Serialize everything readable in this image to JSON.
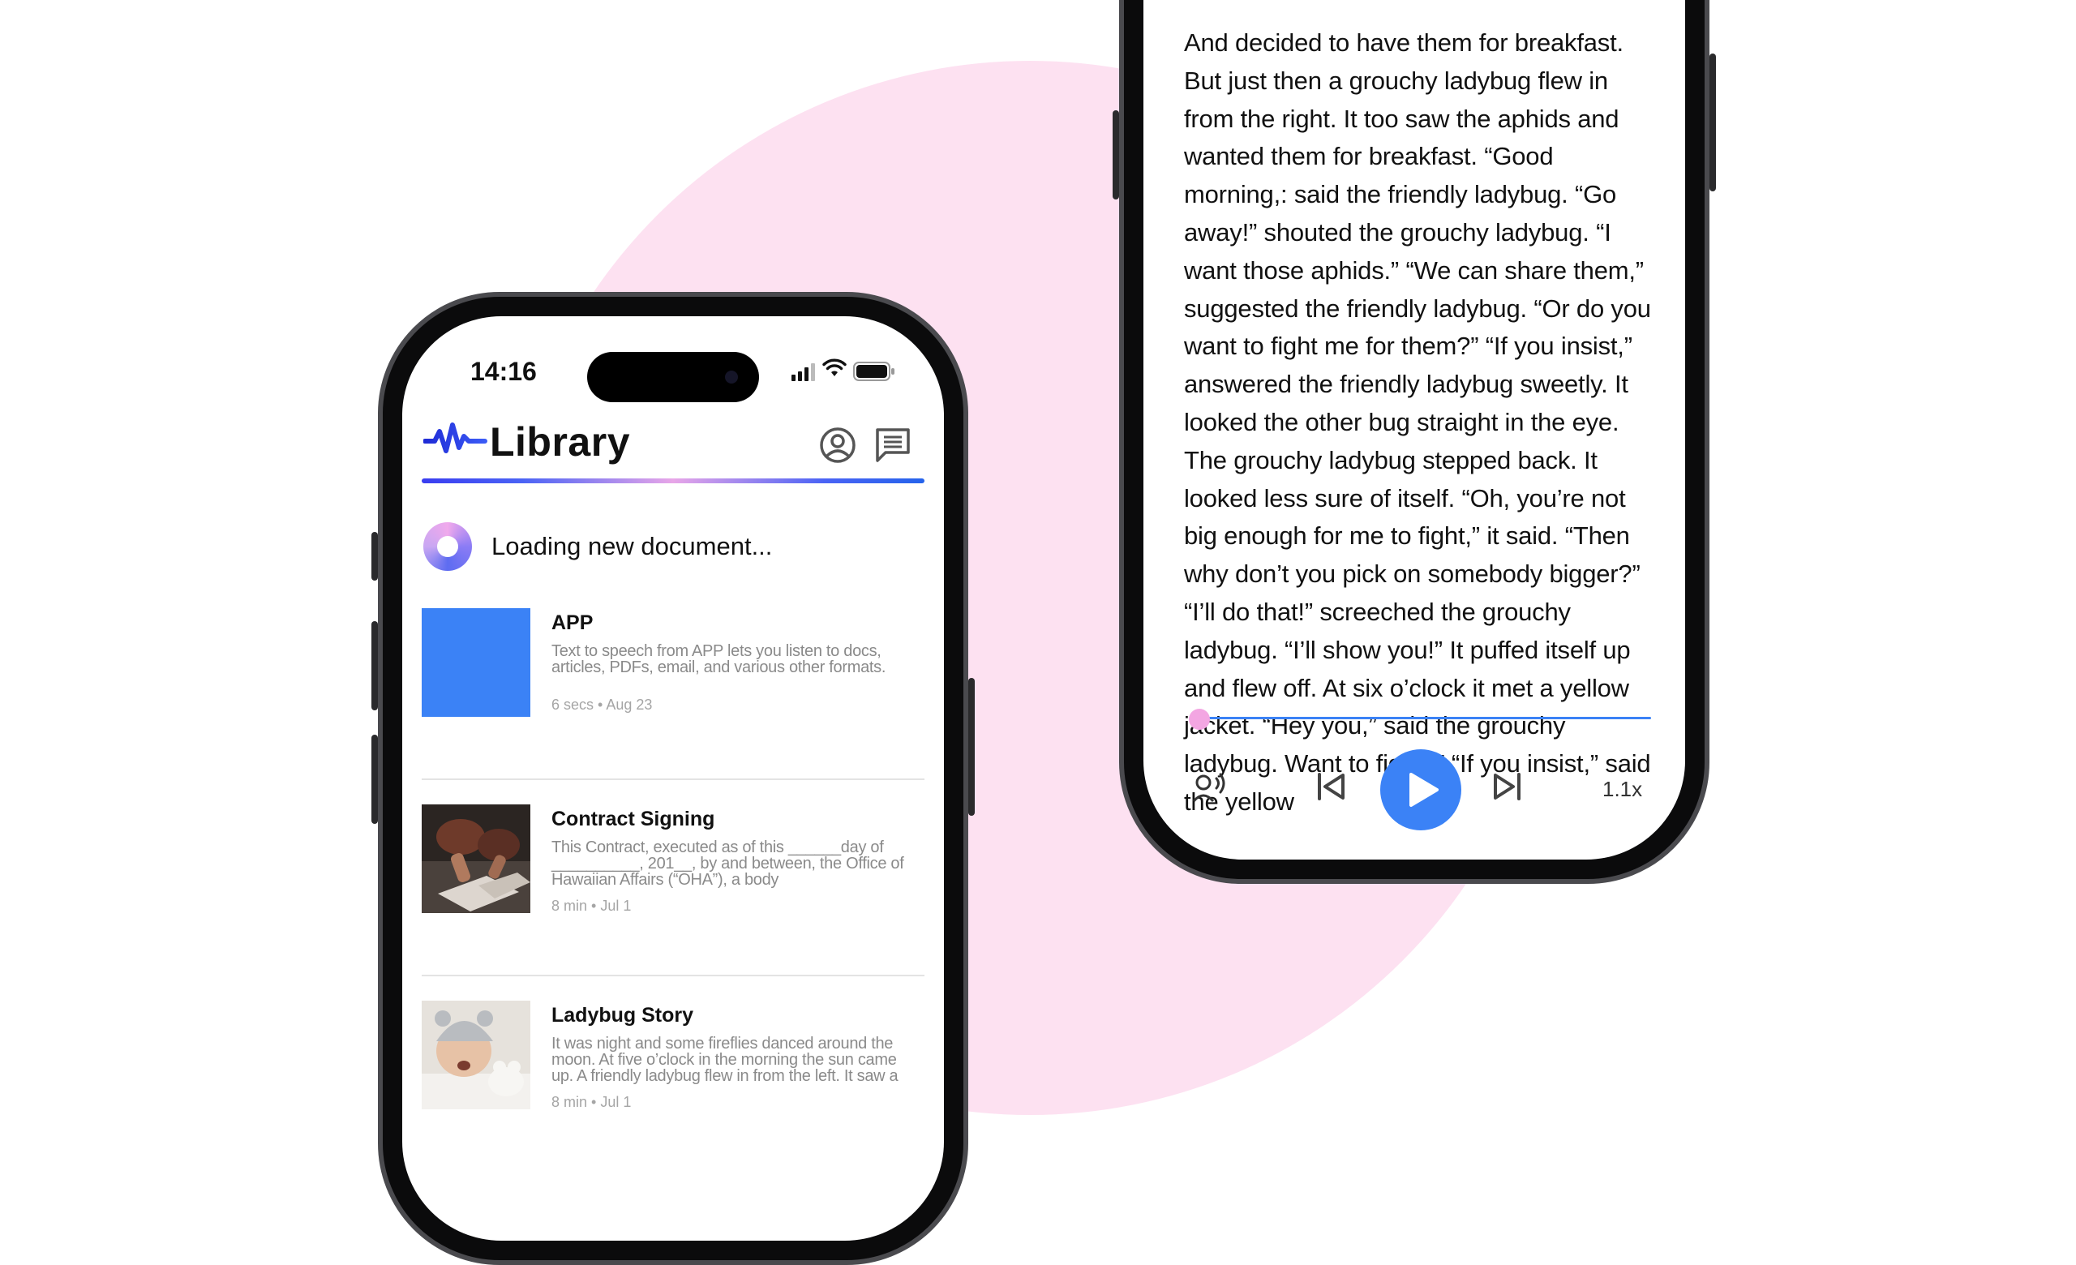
{
  "library_phone": {
    "status": {
      "time": "14:16"
    },
    "header": {
      "title": "Library"
    },
    "loading": {
      "text": "Loading new document..."
    },
    "documents": [
      {
        "title": "APP",
        "description": "Text to speech from APP lets you listen to docs, articles, PDFs, email, and various other formats.",
        "meta": "6 secs • Aug 23",
        "thumb_color": "#3b82f6"
      },
      {
        "title": "Contract Signing",
        "description": "This Contract, executed as of this ______day of __________, 201__, by and between, the Office of Hawaiian Affairs (“OHA”), a body",
        "meta": "8 min • Jul 1"
      },
      {
        "title": "Ladybug Story",
        "description": "It was night and some fireflies danced around the moon. At five o’clock in the morning the sun came up. A friendly ladybug flew in from the left. It saw a",
        "meta": "8 min • Jul 1"
      }
    ]
  },
  "reader_phone": {
    "text": "And decided to have them for breakfast. But just then a grouchy ladybug flew in from the right. It too saw the aphids and wanted them for breakfast. “Good morning,: said the friendly ladybug. “Go away!” shouted the grouchy ladybug. “I want those aphids.” “We can share them,” suggested the friendly ladybug. “Or do you want to fight me for them?” “If you insist,” answered the friendly ladybug sweetly. It looked the other bug straight in the eye. The grouchy ladybug stepped back. It looked less sure of itself. “Oh, you’re not big enough for me to fight,” it said. “Then why don’t you pick on somebody bigger?” “I’ll do that!” screeched the grouchy ladybug. “I’ll show you!” It puffed itself up and flew off. At six o’clock it met a yellow jacket. “Hey you,” said the grouchy ladybug. Want to fight?” “If you insist,” said the yellow",
    "playback": {
      "progress": 0.0,
      "speed": "1.1x",
      "state": "paused"
    }
  },
  "colors": {
    "accent": "#3b82f6",
    "background_circle": "#fde1f1",
    "knob": "#f3a6e2"
  },
  "icons": [
    "waveform-logo-icon",
    "profile-icon",
    "chat-icon",
    "voice-icon",
    "skip-back-icon",
    "play-icon",
    "skip-forward-icon"
  ]
}
